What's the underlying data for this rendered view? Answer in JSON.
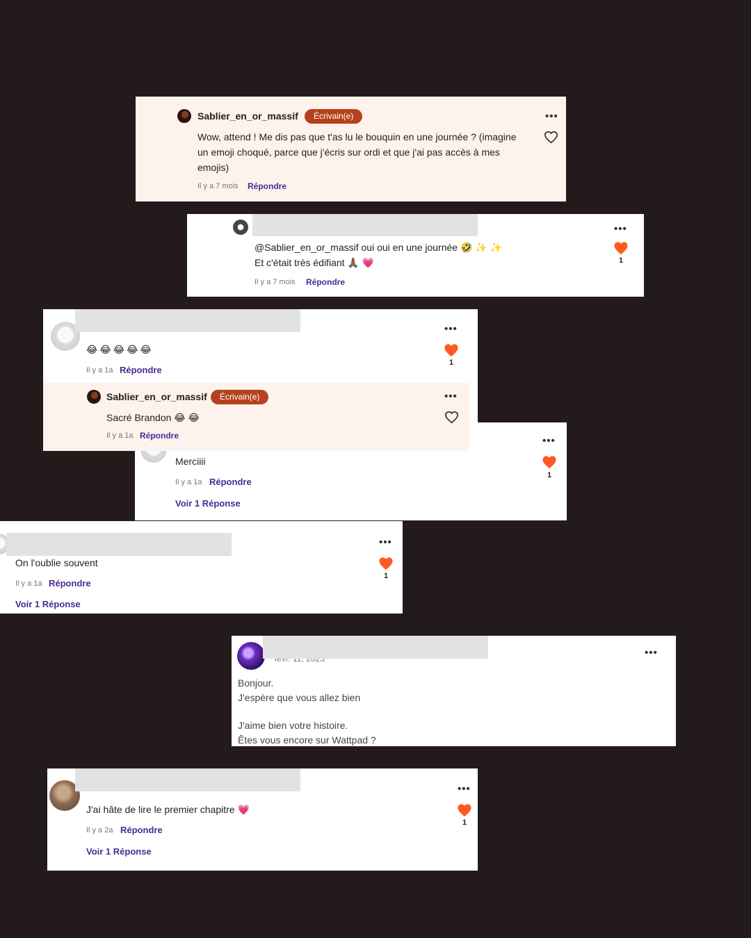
{
  "colors": {
    "background": "#231b1b",
    "author_badge": "#b5421c",
    "reply_link": "#4a2a97",
    "heart": "#ff5a1f",
    "author_bg": "#fdf2ec"
  },
  "icons": {
    "more": "more-options-icon",
    "heart_filled": "heart-filled-icon",
    "heart_outline": "heart-outline-icon"
  },
  "more_glyph": "•••",
  "c1": {
    "username": "Sablier_en_or_massif",
    "badge": "Écrivain(e)",
    "line1": "Wow, attend ! Me dis pas que t'as lu le bouquin en une journée ? (imagine",
    "line2": "un emoji choqué, parce que j'écris sur ordi et que j'ai pas accès à mes",
    "line3": "emojis)",
    "time": "Il y a 7 mois",
    "reply": "Répondre"
  },
  "c2": {
    "line1": "@Sablier_en_or_massif oui oui en une journée 🤣 ✨ ✨",
    "line2": "Et c'était très édifiant 🙏🏾 💗",
    "time": "Il y a 7 mois",
    "reply": "Répondre",
    "likes": "1"
  },
  "c3": {
    "text": "😂😂😂😂😂",
    "time": "Il y a 1a",
    "reply": "Répondre",
    "likes": "1"
  },
  "c3r": {
    "username": "Sablier_en_or_massif",
    "badge": "Écrivain(e)",
    "text": "Sacré Brandon 😂 😂",
    "time": "Il y a 1a",
    "reply": "Répondre"
  },
  "c4": {
    "text": "Merciiii",
    "time": "Il y a 1a",
    "reply": "Répondre",
    "likes": "1",
    "view_replies": "Voir 1 Réponse"
  },
  "c5": {
    "text": "On l'oublie souvent",
    "time": "Il y a 1a",
    "reply": "Répondre",
    "likes": "1",
    "view_replies": "Voir 1 Réponse"
  },
  "c6": {
    "date": "févr. 11, 2023",
    "line1": "Bonjour.",
    "line2": "J'espère que vous allez bien",
    "line3": "J'aime bien votre histoire.",
    "line4": "Êtes vous encore sur Wattpad ?"
  },
  "c7": {
    "text": "J'ai hâte de lire le premier chapitre 💗",
    "time": "Il y a 2a",
    "reply": "Répondre",
    "likes": "1",
    "view_replies": "Voir 1 Réponse"
  }
}
